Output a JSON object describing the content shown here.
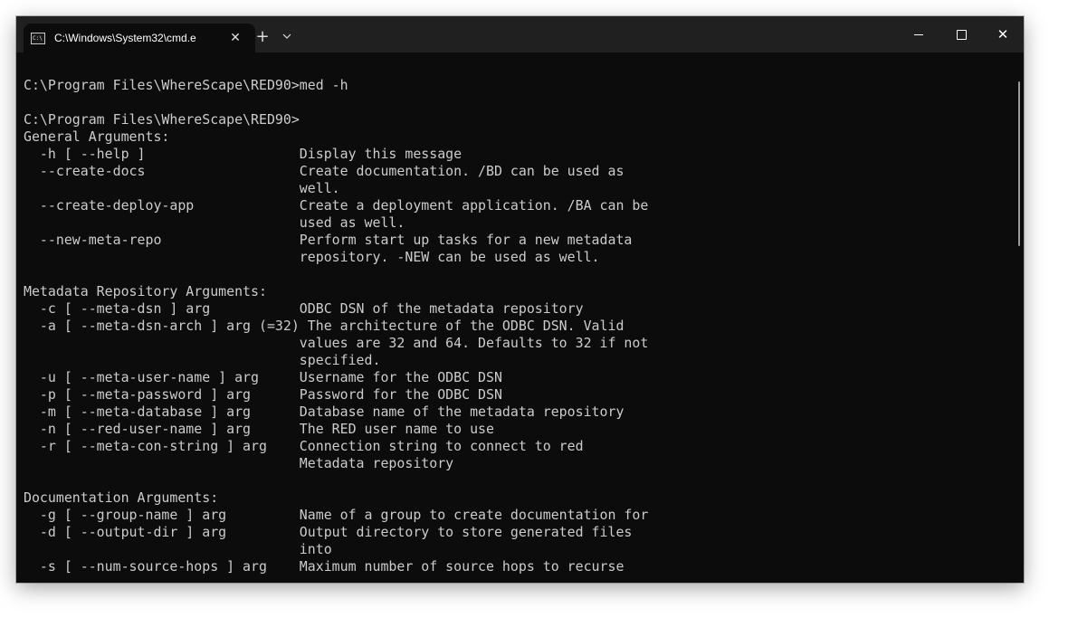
{
  "window": {
    "tab_title": "C:\\Windows\\System32\\cmd.e",
    "tab_icon_glyph": "C:\\",
    "close_tab_glyph": "✕",
    "new_tab_glyph": "+",
    "dropdown_glyph": "⌄",
    "close_window_glyph": "✕",
    "icons": [
      "cmd-icon",
      "close-icon",
      "plus-icon",
      "chevron-down-icon",
      "minimize-icon",
      "maximize-icon",
      "close-icon"
    ]
  },
  "terminal": {
    "colors": {
      "background": "#0c0c0c",
      "foreground": "#cccccc",
      "titlebar": "#202020"
    },
    "lines": [
      "C:\\Program Files\\WhereScape\\RED90>med -h",
      "",
      "C:\\Program Files\\WhereScape\\RED90>",
      "General Arguments:",
      "  -h [ --help ]                   Display this message",
      "  --create-docs                   Create documentation. /BD can be used as",
      "                                  well.",
      "  --create-deploy-app             Create a deployment application. /BA can be",
      "                                  used as well.",
      "  --new-meta-repo                 Perform start up tasks for a new metadata",
      "                                  repository. -NEW can be used as well.",
      "",
      "Metadata Repository Arguments:",
      "  -c [ --meta-dsn ] arg           ODBC DSN of the metadata repository",
      "  -a [ --meta-dsn-arch ] arg (=32) The architecture of the ODBC DSN. Valid",
      "                                  values are 32 and 64. Defaults to 32 if not",
      "                                  specified.",
      "  -u [ --meta-user-name ] arg     Username for the ODBC DSN",
      "  -p [ --meta-password ] arg      Password for the ODBC DSN",
      "  -m [ --meta-database ] arg      Database name of the metadata repository",
      "  -n [ --red-user-name ] arg      The RED user name to use",
      "  -r [ --meta-con-string ] arg    Connection string to connect to red",
      "                                  Metadata repository",
      "",
      "Documentation Arguments:",
      "  -g [ --group-name ] arg         Name of a group to create documentation for",
      "  -d [ --output-dir ] arg         Output directory to store generated files",
      "                                  into",
      "  -s [ --num-source-hops ] arg    Maximum number of source hops to recurse"
    ]
  }
}
